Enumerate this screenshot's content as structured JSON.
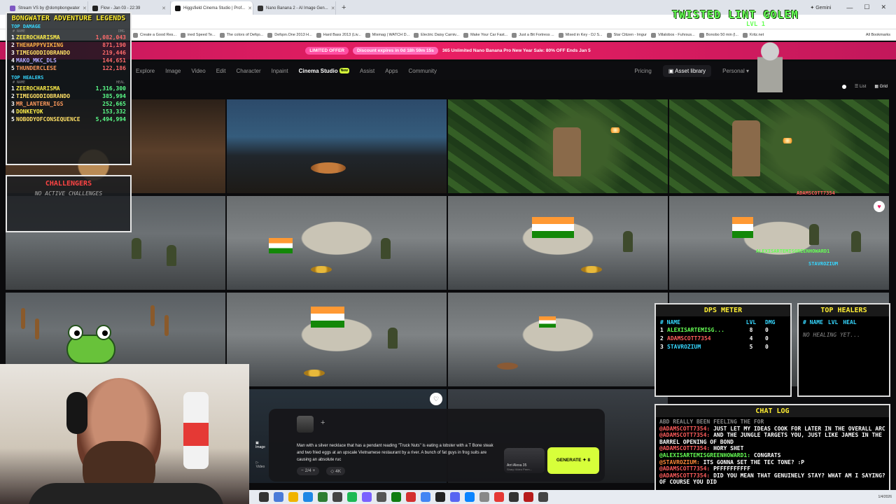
{
  "browser": {
    "tabs": [
      {
        "label": "Stream VS by @dompbongwater",
        "active": false,
        "color": "#7e57c2"
      },
      {
        "label": "Flow - Jan 03 - 22:39",
        "active": false,
        "color": "#222222"
      },
      {
        "label": "Higgsfield Cinema Studio | Prof...",
        "active": true,
        "color": "#111111"
      },
      {
        "label": "Nano Banana 2 - AI Image Gen...",
        "active": false,
        "color": "#333333"
      }
    ],
    "new_tab": "+",
    "gemini_label": "Gemini",
    "bookmarks": [
      "Create a Good Res...",
      "ined Speed Te...",
      "The colors of Defqo...",
      "Defqon.One 2013 H...",
      "Hard Bass 2013 (Liv...",
      "Mixmag | WATCH D...",
      "Electric Daisy Carniv...",
      "Make Your Car Fast...",
      "Just a Bit Fortress ...",
      "Mixed in Key - DJ S...",
      "Star Citizen - Imgur",
      "Villalobos - Fuhrsus...",
      "Bonobo 50 min (l...",
      "Kritz.net"
    ],
    "all_bookmarks": "All Bookmarks"
  },
  "promo": {
    "limited": "LIMITED OFFER",
    "discount": "Discount expires in 0d 18h 59m 15s",
    "message": "365 Unlimited Nano Banana Pro New Year Sale: 80% OFF Ends Jan 5"
  },
  "nav": {
    "items": [
      "Explore",
      "Image",
      "Video",
      "Edit",
      "Character",
      "Inpaint",
      "Cinema Studio",
      "Assist",
      "Apps",
      "Community"
    ],
    "active": "Cinema Studio",
    "new_badge": "New",
    "pricing": "Pricing",
    "asset_library": "Asset library",
    "workspace": "Personal"
  },
  "view": {
    "list": "List",
    "grid": "Grid"
  },
  "scoreboard": {
    "title": "BONGWATER ADVENTURE LEGENDS",
    "damage_title": "TOP DAMAGE",
    "col_name": "# NAME",
    "col_dmg": "DMG",
    "damage": [
      {
        "rank": "1",
        "name": "ZEEROCHARISMA",
        "value": "1,082,043"
      },
      {
        "rank": "2",
        "name": "THEHAPPYVIKING",
        "value": "871,190"
      },
      {
        "rank": "3",
        "name": "TIMEGODDIOBRANDO",
        "value": "219,446"
      },
      {
        "rank": "4",
        "name": "MAKO_MKC_DLS",
        "value": "144,651"
      },
      {
        "rank": "5",
        "name": "THUNDERCLESE",
        "value": "122,186"
      }
    ],
    "healers_title": "TOP HEALERS",
    "col_heal": "HEAL",
    "healers": [
      {
        "rank": "1",
        "name": "ZEEROCHARISMA",
        "value": "1,316,300"
      },
      {
        "rank": "2",
        "name": "TIMEGODDIOBRANDO",
        "value": "385,994"
      },
      {
        "rank": "3",
        "name": "MR_LANTERN_IGS",
        "value": "252,665"
      },
      {
        "rank": "4",
        "name": "DONKEYOK",
        "value": "153,332"
      },
      {
        "rank": "5",
        "name": "NOBODYOFCONSEQUENCE",
        "value": "5,494,994"
      }
    ]
  },
  "challengers": {
    "title": "CHALLENGERS",
    "empty": "NO ACTIVE CHALLENGES"
  },
  "golem": {
    "name": "TWISTED LINT GOLEM",
    "level": "LVL 1"
  },
  "player_tags": [
    "ADAMSCOTT7354",
    "ALEXISARTEMISGREENHOWARD1",
    "STAVROZIUM"
  ],
  "dps": {
    "title": "DPS METER",
    "cols": [
      "# NAME",
      "LVL",
      "DMG"
    ],
    "rows": [
      {
        "rank": "1",
        "name": "ALEXISARTEMISG...",
        "lvl": "8",
        "dmg": "0",
        "color": "#66ff55"
      },
      {
        "rank": "2",
        "name": "ADAMSCOTT7354",
        "lvl": "4",
        "dmg": "0",
        "color": "#ff5c5c"
      },
      {
        "rank": "3",
        "name": "STAVROZIUM",
        "lvl": "5",
        "dmg": "0",
        "color": "#36d7ff"
      }
    ]
  },
  "top_healers": {
    "title": "TOP HEALERS",
    "cols": [
      "# NAME",
      "LVL",
      "HEAL"
    ],
    "empty": "NO HEALING YET..."
  },
  "chat": {
    "title": "CHAT LOG",
    "lines": [
      {
        "who": "",
        "text": "ABD REALLY BEEN FEELING THE FOR",
        "green": false
      },
      {
        "who": "@ADAMSCOTT7354:",
        "text": " JUST LET MY IDEAS COOK FOR LATER IN THE OVERALL ARC",
        "green": false
      },
      {
        "who": "@ADAMSCOTT7354:",
        "text": " AND THE JUNGLE TARGETS YOU, JUST LIKE JAMES IN THE BARREL OPENING OF BOND",
        "green": false
      },
      {
        "who": "@ADAMSCOTT7354:",
        "text": " HORY SHET",
        "green": false
      },
      {
        "who": "@ALEXISARTEMISGREENHOWARD1:",
        "text": " CONGRATS",
        "green": true
      },
      {
        "who": "@STAVROZIUM:",
        "text": " ITS GONNA SET THE TEC TONE? :P",
        "green": false
      },
      {
        "who": "@ADAMSCOTT7354:",
        "text": " PFFFFFFFFFF",
        "green": false
      },
      {
        "who": "@ADAMSCOTT7354:",
        "text": " DID YOU MEAN THAT GENUINELY STAY? WHAT AM I SAYING? OF COURSE YOU DID",
        "green": false
      }
    ]
  },
  "composer": {
    "side": [
      {
        "label": "Image",
        "active": true
      },
      {
        "label": "Video",
        "active": false
      }
    ],
    "prompt": "Man with a silver necklace that has a pendant reading \"Truck Nuts\" is eating a lobster with a T Bone steak and two fried eggs at an upscale Vietnamese restaurant by a river. A bunch of fat guys in frog suits are causing an absolute ruc",
    "count": "2/4",
    "resolution": "4K",
    "model": "Arri Alexa 35",
    "model_sub": "Sharp Video Prem...",
    "generate": "GENERATE",
    "cost": "8"
  },
  "tray": {
    "time": "1/4/2026"
  }
}
